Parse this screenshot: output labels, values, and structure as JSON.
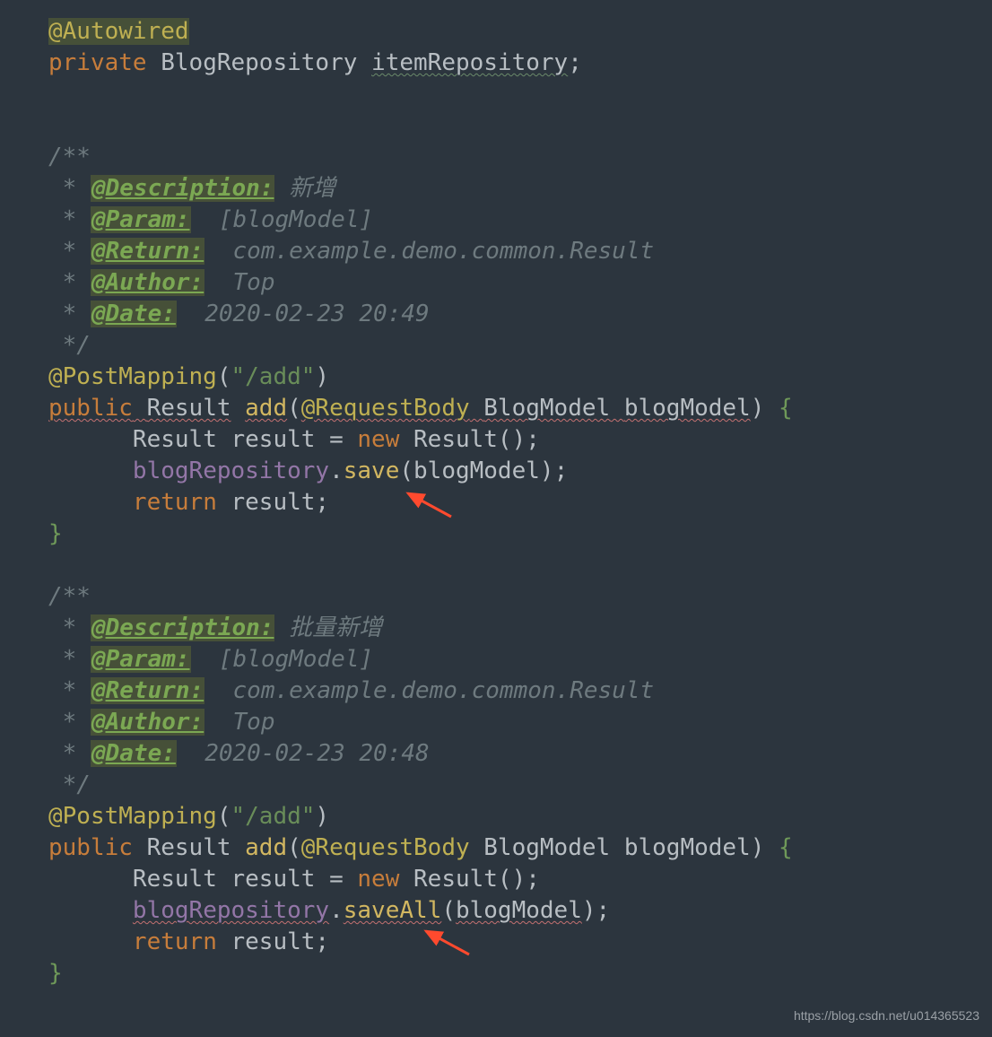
{
  "code": {
    "autowired": "@Autowired",
    "private": "private",
    "blogRepoType": "BlogRepository",
    "itemRepo": "itemRepository",
    "semi": ";",
    "docOpen": "/**",
    "star": " * ",
    "docClose": " */",
    "tags": {
      "description": "@Description:",
      "param": "@Param:",
      "return": "@Return:",
      "author": "@Author:",
      "date": "@Date:"
    },
    "block1": {
      "desc": " 新增",
      "param": "  [blogModel]",
      "ret": "  com.example.demo.common.Result",
      "author": "  Top",
      "date": "  2020-02-23 20:49"
    },
    "block2": {
      "desc": " 批量新增",
      "param": "  [blogModel]",
      "ret": "  com.example.demo.common.Result",
      "author": "  Top",
      "date": "  2020-02-23 20:48"
    },
    "postMapping": "@PostMapping",
    "lparen": "(",
    "rparen": ")",
    "addPath": "\"/add\"",
    "public": "public",
    "resultType": "Result",
    "addName": "add",
    "reqBody": "@RequestBody",
    "blogModelType": "BlogModel",
    "blogModelVar": "blogModel",
    "lbrace": "{",
    "rbrace": "}",
    "indent": "      ",
    "resultVar": "result",
    "eq": " = ",
    "new": "new",
    "resultCtor": "Result()",
    "blogRepo": "blogRepository",
    "dot": ".",
    "save": "save",
    "saveAll": "saveAll",
    "return": "return"
  },
  "watermark": "https://blog.csdn.net/u014365523"
}
